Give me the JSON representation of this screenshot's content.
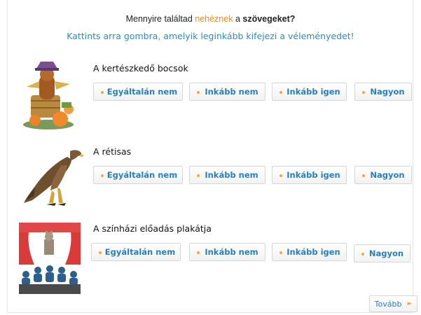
{
  "header": {
    "title_pre": "Mennyire találtad ",
    "title_hl": "nehéznek",
    "title_mid": " a ",
    "title_bold": "szövegeket?",
    "instruction": "Kattints arra gombra, amelyik leginkább kifejezi a véleményedet!"
  },
  "options": [
    "Egyáltalán nem",
    "Inkább nem",
    "Inkább igen",
    "Nagyon"
  ],
  "items": [
    {
      "label": "A kertészkedő bocsok",
      "image": "scarecrow-bear-with-pumpkins"
    },
    {
      "label": "A rétisas",
      "image": "eagle"
    },
    {
      "label": "A színházi előadás plakátja",
      "image": "theater-stage-audience"
    }
  ],
  "footer": {
    "next_label": "Tovább"
  },
  "colors": {
    "accent_orange": "#f08c1e",
    "link_blue": "#2a8fb0",
    "button_text": "#2a7fb8",
    "bullet": "#f4a83a"
  }
}
